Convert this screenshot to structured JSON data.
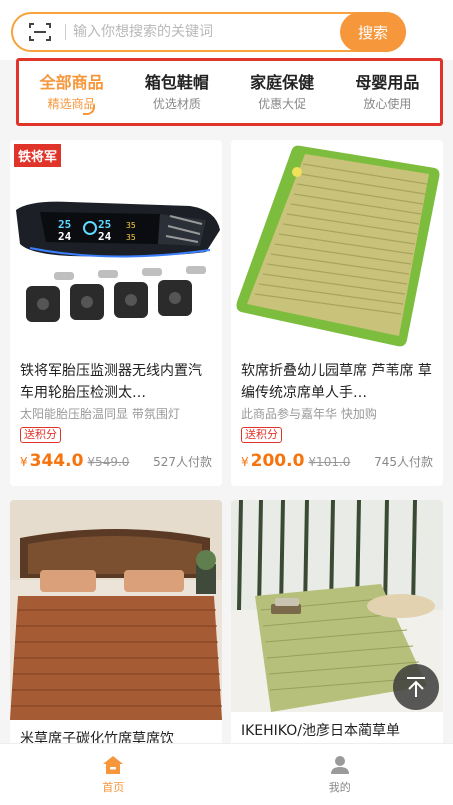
{
  "search": {
    "placeholder": "输入你想搜索的关键词",
    "button_label": "搜索"
  },
  "tabs": [
    {
      "title": "全部商品",
      "sub": "精选商品",
      "active": true
    },
    {
      "title": "箱包鞋帽",
      "sub": "优选材质",
      "active": false
    },
    {
      "title": "家庭保健",
      "sub": "优惠大促",
      "active": false
    },
    {
      "title": "母婴用品",
      "sub": "放心使用",
      "active": false
    }
  ],
  "products": [
    {
      "brand_tag": "铁将军",
      "title": "铁将军胎压监测器无线内置汽车用轮胎压检测太…",
      "sub": "太阳能胎压胎温同显 带氛围灯",
      "badge": "送积分",
      "price_symbol": "¥",
      "price": "344.0",
      "original_price": "¥549.0",
      "sold": "527人付款",
      "image": "tire-pressure-monitor"
    },
    {
      "title": "软席折叠幼儿园草席 芦苇席 草编传统凉席单人手…",
      "sub": "此商品参与嘉年华 快加购",
      "badge": "送积分",
      "price_symbol": "¥",
      "price": "200.0",
      "original_price": "¥101.0",
      "sold": "745人付款",
      "image": "folding-straw-mat"
    },
    {
      "title": "米草席子碳化竹席草席饮",
      "image": "bamboo-mat-bed"
    },
    {
      "title": "IKEHIKO/池彦日本蔺草单",
      "image": "rush-grass-mat"
    }
  ],
  "bottom_bar": [
    {
      "label": "首页",
      "icon": "home-icon",
      "active": true
    },
    {
      "label": "我的",
      "icon": "user-icon",
      "active": false
    }
  ],
  "colors": {
    "accent": "#f7973c",
    "price": "#f7730c",
    "red": "#e0342b"
  }
}
